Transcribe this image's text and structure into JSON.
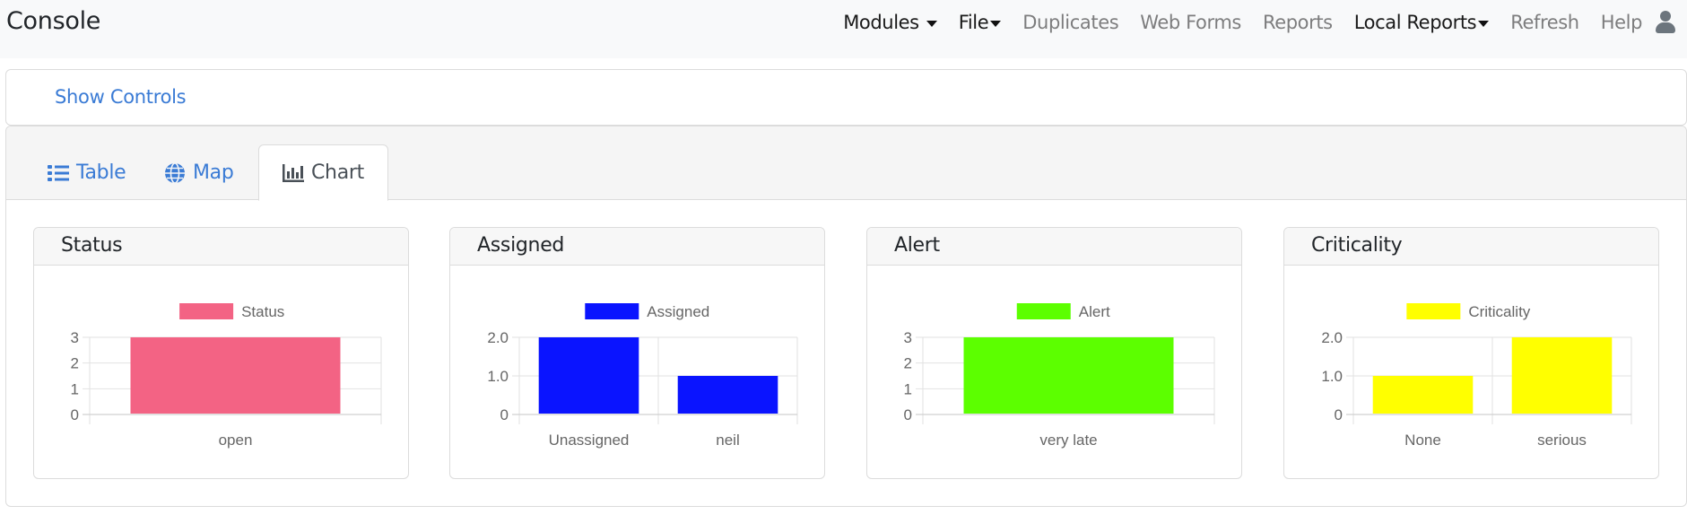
{
  "navbar": {
    "brand": "Console",
    "items": [
      {
        "label": "Modules",
        "dropdown": true,
        "active": true
      },
      {
        "label": "File",
        "dropdown": true,
        "active": true
      },
      {
        "label": "Duplicates",
        "dropdown": false,
        "active": false
      },
      {
        "label": "Web Forms",
        "dropdown": false,
        "active": false
      },
      {
        "label": "Reports",
        "dropdown": false,
        "active": false
      },
      {
        "label": "Local Reports",
        "dropdown": true,
        "active": true
      },
      {
        "label": "Refresh",
        "dropdown": false,
        "active": false
      },
      {
        "label": "Help",
        "dropdown": false,
        "active": false
      }
    ],
    "user_icon": "user-icon"
  },
  "controls": {
    "show_controls_label": "Show Controls"
  },
  "tabs": [
    {
      "label": "Table",
      "icon": "list-icon",
      "active": false
    },
    {
      "label": "Map",
      "icon": "globe-icon",
      "active": false
    },
    {
      "label": "Chart",
      "icon": "bar-chart-icon",
      "active": true
    }
  ],
  "colors": {
    "link": "#3a7bd5",
    "status": "#f36384",
    "assigned": "#0a14ff",
    "alert": "#5cff00",
    "criticality": "#ffff00"
  },
  "chart_data": [
    {
      "type": "bar",
      "title": "Status",
      "legend": "Status",
      "legend_position": "top",
      "color": "#f36384",
      "categories": [
        "open"
      ],
      "values": [
        3
      ],
      "yticks": [
        "0",
        "1",
        "2",
        "3"
      ],
      "ylim": [
        0,
        3
      ],
      "grid": true,
      "xlabel": "",
      "ylabel": ""
    },
    {
      "type": "bar",
      "title": "Assigned",
      "legend": "Assigned",
      "legend_position": "top",
      "color": "#0a14ff",
      "categories": [
        "Unassigned",
        "neil"
      ],
      "values": [
        2,
        1
      ],
      "yticks": [
        "0",
        "1.0",
        "2.0"
      ],
      "ylim": [
        0,
        2
      ],
      "grid": true,
      "xlabel": "",
      "ylabel": ""
    },
    {
      "type": "bar",
      "title": "Alert",
      "legend": "Alert",
      "legend_position": "top",
      "color": "#5cff00",
      "categories": [
        "very late"
      ],
      "values": [
        3
      ],
      "yticks": [
        "0",
        "1",
        "2",
        "3"
      ],
      "ylim": [
        0,
        3
      ],
      "grid": true,
      "xlabel": "",
      "ylabel": ""
    },
    {
      "type": "bar",
      "title": "Criticality",
      "legend": "Criticality",
      "legend_position": "top",
      "color": "#ffff00",
      "categories": [
        "None",
        "serious"
      ],
      "values": [
        1,
        2
      ],
      "yticks": [
        "0",
        "1.0",
        "2.0"
      ],
      "ylim": [
        0,
        2
      ],
      "grid": true,
      "xlabel": "",
      "ylabel": ""
    }
  ]
}
